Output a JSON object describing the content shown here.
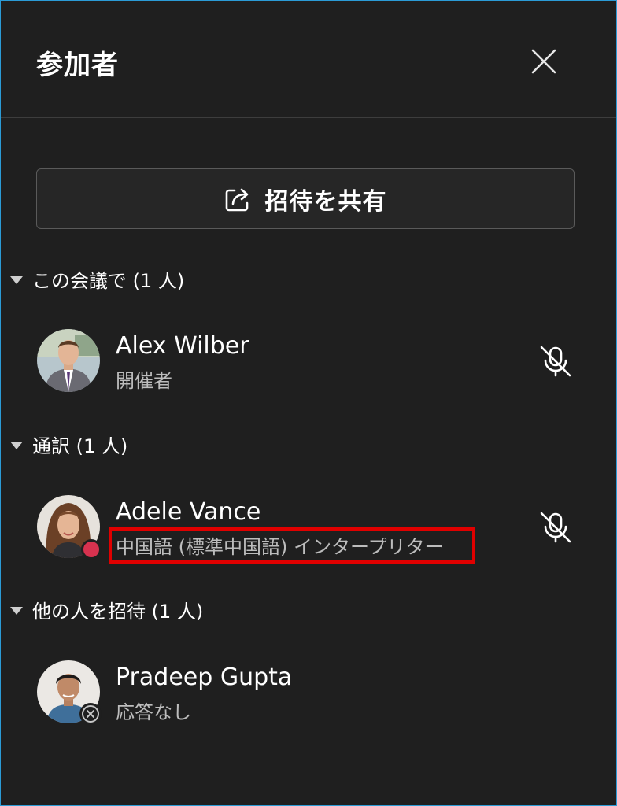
{
  "panel": {
    "title": "参加者",
    "close_icon": "close-icon"
  },
  "share": {
    "label": "招待を共有",
    "icon": "share-icon"
  },
  "sections": [
    {
      "header": "この会議で (1 人)",
      "participants": [
        {
          "name": "Alex Wilber",
          "role": "開催者",
          "avatar": "avatar-alex",
          "mic_icon": "mic-off-icon"
        }
      ]
    },
    {
      "header": "通訳 (1 人)",
      "participants": [
        {
          "name": "Adele Vance",
          "role": "中国語 (標準中国語) インタープリター",
          "avatar": "avatar-adele",
          "status_color": "#d7324f",
          "mic_icon": "mic-off-icon"
        }
      ]
    },
    {
      "header": "他の人を招待 (1 人)",
      "participants": [
        {
          "name": "Pradeep Gupta",
          "role": "応答なし",
          "avatar": "avatar-pradeep",
          "status_icon": "declined-x-icon"
        }
      ]
    }
  ],
  "colors": {
    "background": "#1f1f1f",
    "border_accent": "#2b9bd6",
    "highlight": "#e00000",
    "secondary_text": "#bdbdbd"
  }
}
